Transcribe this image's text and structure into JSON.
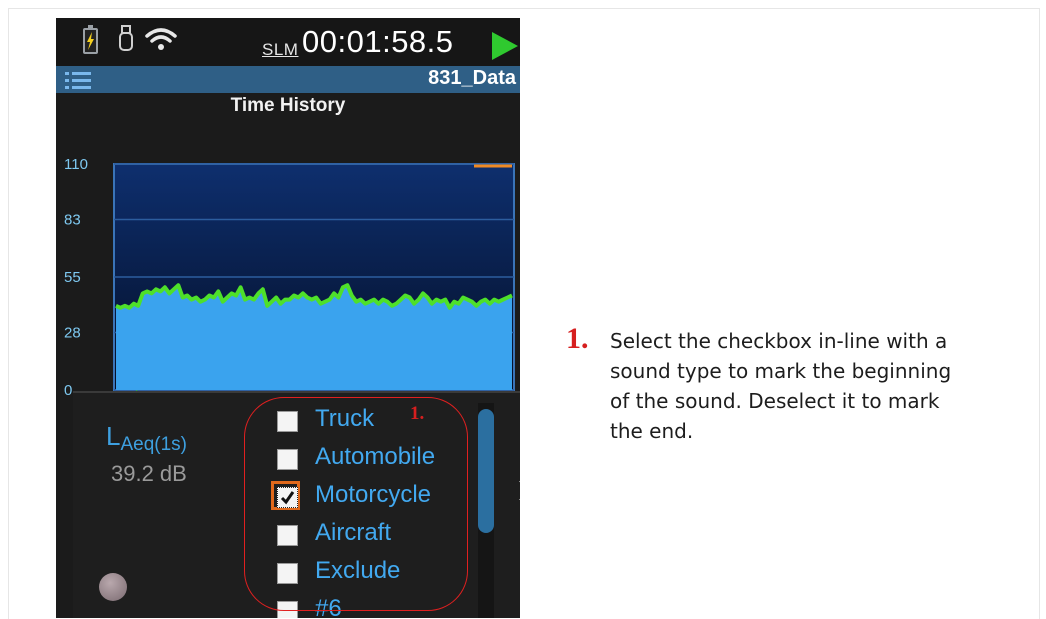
{
  "device": {
    "mode_label": "SLM",
    "timer": "00:01:58.5",
    "file_name": "831_Data",
    "screen_title": "Time History"
  },
  "chart_data": {
    "type": "area",
    "title": "Time History",
    "yticks": [
      110,
      83,
      55,
      28,
      0
    ],
    "ylim": [
      0,
      110
    ],
    "grid": true,
    "fill_color": "#3aa3ee",
    "line_color": "#4ee02a",
    "marker_color": "#f08a24",
    "values": [
      41,
      40,
      41,
      40,
      42,
      41,
      47,
      48,
      47,
      49,
      48,
      50,
      47,
      49,
      51,
      45,
      46,
      44,
      45,
      43,
      44,
      46,
      45,
      48,
      43,
      45,
      47,
      46,
      50,
      44,
      45,
      44,
      47,
      49,
      41,
      43,
      45,
      42,
      44,
      44,
      46,
      45,
      47,
      45,
      44,
      45,
      42,
      43,
      44,
      47,
      45,
      50,
      51,
      46,
      43,
      44,
      42,
      43,
      44,
      42,
      44,
      43,
      41,
      42,
      44,
      46,
      45,
      42,
      44,
      47,
      45,
      42,
      44,
      43,
      44,
      40,
      43,
      42,
      45,
      44,
      43,
      41,
      43,
      44,
      42,
      44,
      43,
      44,
      45,
      46
    ]
  },
  "panel": {
    "metric_main": "L",
    "metric_sub": "Aeq(1s)",
    "metric_value": "39.2 dB",
    "sound_types": [
      {
        "label": "Truck",
        "checked": false
      },
      {
        "label": "Automobile",
        "checked": false
      },
      {
        "label": "Motorcycle",
        "checked": true
      },
      {
        "label": "Aircraft",
        "checked": false
      },
      {
        "label": "Exclude",
        "checked": false
      },
      {
        "label": "#6",
        "checked": false
      }
    ],
    "clipped_text": ")"
  },
  "annotation": {
    "marker": "1.",
    "instruction_number": "1.",
    "instruction_text": "Select the checkbox in-line with a sound type to mark the beginning of the sound. Deselect it to mark the end."
  },
  "colors": {
    "accent_blue": "#3ea0e0",
    "title_bar": "#2f5f86",
    "annotation_red": "#d61f1f",
    "focus_orange": "#e0691c"
  },
  "icons": [
    "battery-charging-icon",
    "usb-icon",
    "wifi-icon",
    "play-icon",
    "menu-icon",
    "checkmark-icon"
  ]
}
